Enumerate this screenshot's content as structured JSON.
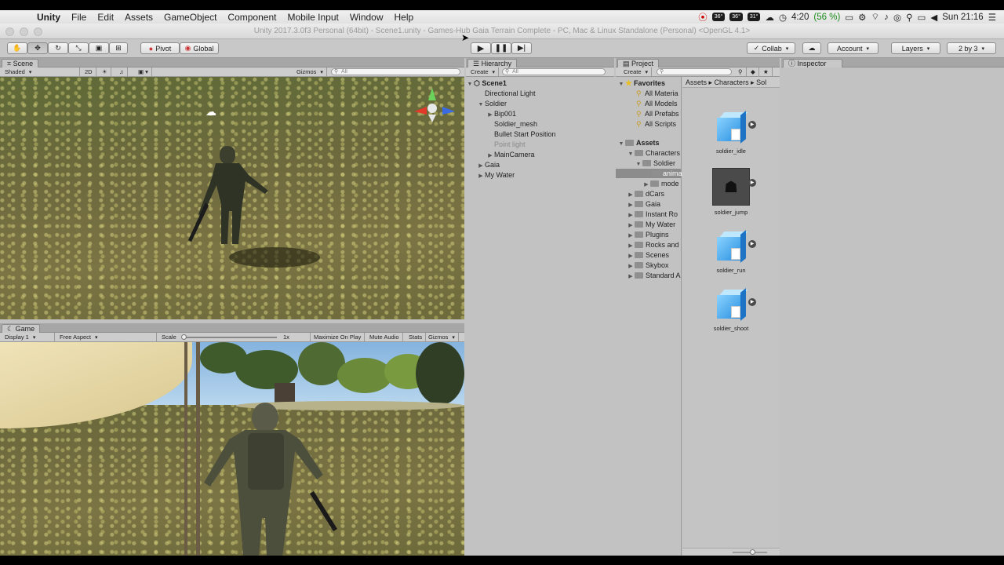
{
  "menubar": {
    "app": "Unity",
    "items": [
      "File",
      "Edit",
      "Assets",
      "GameObject",
      "Component",
      "Mobile Input",
      "Window",
      "Help"
    ],
    "tray": {
      "t1": "36°",
      "t2": "36°",
      "t3": "31°",
      "battery_time": "4:20",
      "battery_pct": "(56 %)",
      "clock": "Sun 21:16"
    }
  },
  "window": {
    "title": "Unity 2017.3.0f3 Personal (64bit) - Scene1.unity - Games-Hub Gaia Terrain Complete - PC, Mac & Linux Standalone (Personal) <OpenGL 4.1>"
  },
  "toolbar": {
    "pivot": "Pivot",
    "global": "Global",
    "collab": "Collab",
    "account": "Account",
    "layers": "Layers",
    "layout": "2 by 3"
  },
  "scene": {
    "tab": "Scene",
    "shading": "Shaded",
    "mode2d": "2D",
    "gizmos": "Gizmos",
    "search_placeholder": "All"
  },
  "game": {
    "tab": "Game",
    "display": "Display 1",
    "aspect": "Free Aspect",
    "scale_label": "Scale",
    "scale_value": "1x",
    "maximize": "Maximize On Play",
    "mute": "Mute Audio",
    "stats": "Stats",
    "gizmos": "Gizmos"
  },
  "hierarchy": {
    "tab": "Hierarchy",
    "create": "Create",
    "search_placeholder": "All",
    "items": [
      {
        "label": "Scene1"
      },
      {
        "label": "Directional Light"
      },
      {
        "label": "Soldier"
      },
      {
        "label": "Bip001"
      },
      {
        "label": "Soldier_mesh"
      },
      {
        "label": "Bullet Start Position"
      },
      {
        "label": "Point light"
      },
      {
        "label": "MainCamera"
      },
      {
        "label": "Gaia"
      },
      {
        "label": "My Water"
      }
    ]
  },
  "project": {
    "tab": "Project",
    "create": "Create",
    "favorites_label": "Favorites",
    "favorites": [
      "All Materia",
      "All Models",
      "All Prefabs",
      "All Scripts"
    ],
    "assets_label": "Assets",
    "tree": [
      "Characters",
      "Soldier",
      "anima",
      "mode",
      "dCars",
      "Gaia",
      "Instant Ro",
      "My Water",
      "Plugins",
      "Rocks and",
      "Scenes",
      "Skybox",
      "Standard A"
    ],
    "breadcrumb": [
      "Assets",
      "Characters",
      "Sol"
    ],
    "assets": [
      "soldier_idle",
      "soldier_jump",
      "soldier_run",
      "soldier_shoot"
    ]
  },
  "inspector": {
    "tab": "Inspector"
  }
}
